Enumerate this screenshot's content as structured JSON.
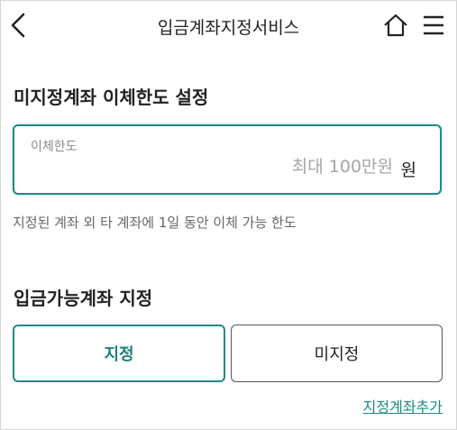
{
  "header": {
    "title": "입금계좌지정서비스",
    "back_icon": "chevron-left-icon",
    "home_icon": "home-icon",
    "menu_icon": "hamburger-menu-icon"
  },
  "limit_section": {
    "title": "미지정계좌 이체한도 설정",
    "field_label": "이체한도",
    "placeholder": "최대 100만원",
    "value": "",
    "unit": "원",
    "help_text": "지정된 계좌 외 타 계좌에 1일 동안 이체 가능 한도"
  },
  "account_section": {
    "title": "입금가능계좌 지정",
    "options": [
      {
        "label": "지정",
        "selected": true
      },
      {
        "label": "미지정",
        "selected": false
      }
    ],
    "add_link": "지정계좌추가"
  },
  "colors": {
    "accent": "#1f8a85",
    "text": "#222222",
    "muted": "#8a8a8a"
  }
}
